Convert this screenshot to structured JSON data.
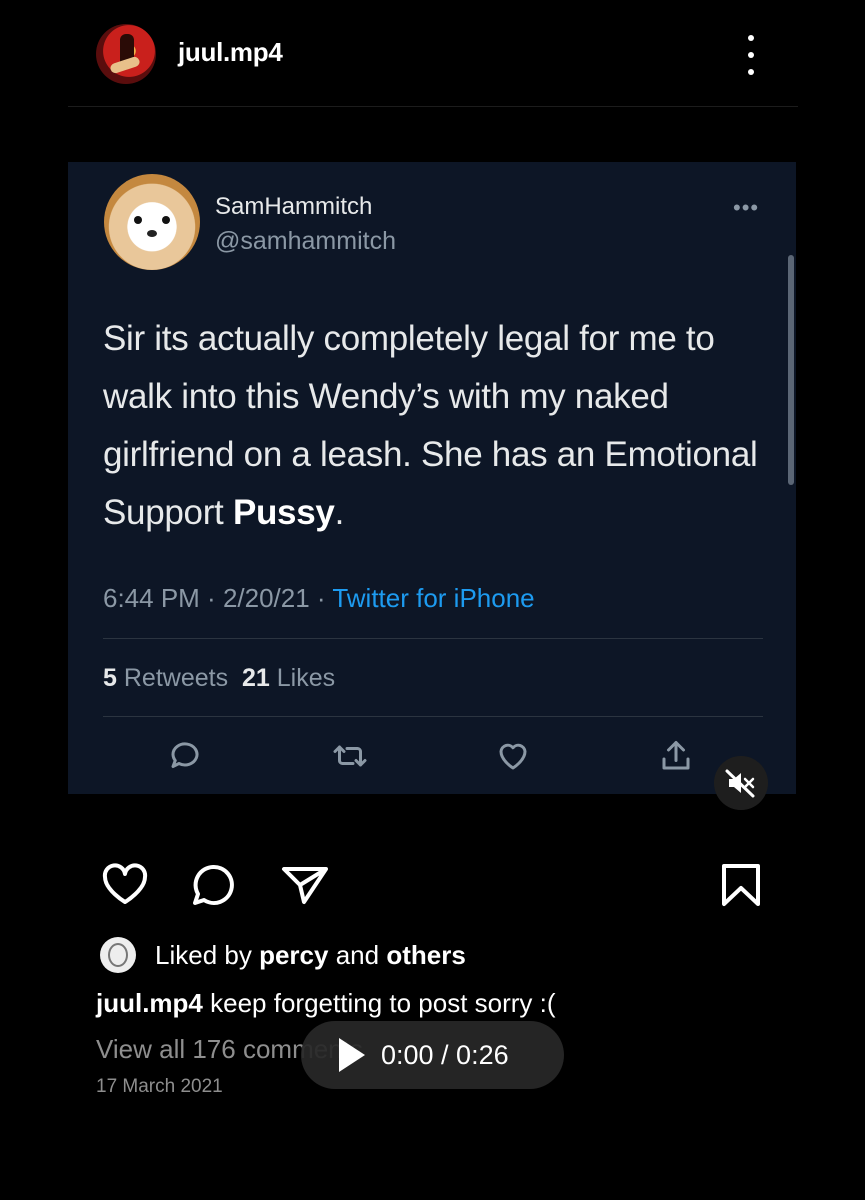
{
  "post": {
    "username": "juul.mp4",
    "liked_by_prefix": "Liked by",
    "liked_by_user": "percy",
    "liked_by_and": "and",
    "liked_by_others": "others",
    "caption_user": "juul.mp4",
    "caption_text": "keep forgetting to post sorry :(",
    "view_comments": "View all 176 comments",
    "date": "17 March 2021"
  },
  "tweet": {
    "name": "SamHammitch",
    "handle": "@samhammitch",
    "more": "•••",
    "body_text": "Sir its actually completely legal for me to walk into this Wendy’s with my naked girlfriend on a leash. She has an Emotional Support",
    "body_bold": "Pussy",
    "body_end": ".",
    "time": "6:44 PM",
    "sep1": " · ",
    "date": "2/20/21",
    "sep2": " · ",
    "source": "Twitter for iPhone",
    "retweets_count": "5",
    "retweets_label": "Retweets",
    "likes_count": "21",
    "likes_label": "Likes"
  },
  "player": {
    "time": "0:00 / 0:26"
  },
  "icons": {
    "more": "more-vertical-icon",
    "like": "heart-icon",
    "comment": "comment-icon",
    "share": "send-icon",
    "save": "bookmark-icon",
    "mute": "muted-speaker-icon",
    "play": "play-icon"
  },
  "colors": {
    "background": "#000000",
    "tweet_background": "#0d1626",
    "twitter_blue": "#1d9bf0",
    "muted_text": "#8e8e8e"
  }
}
